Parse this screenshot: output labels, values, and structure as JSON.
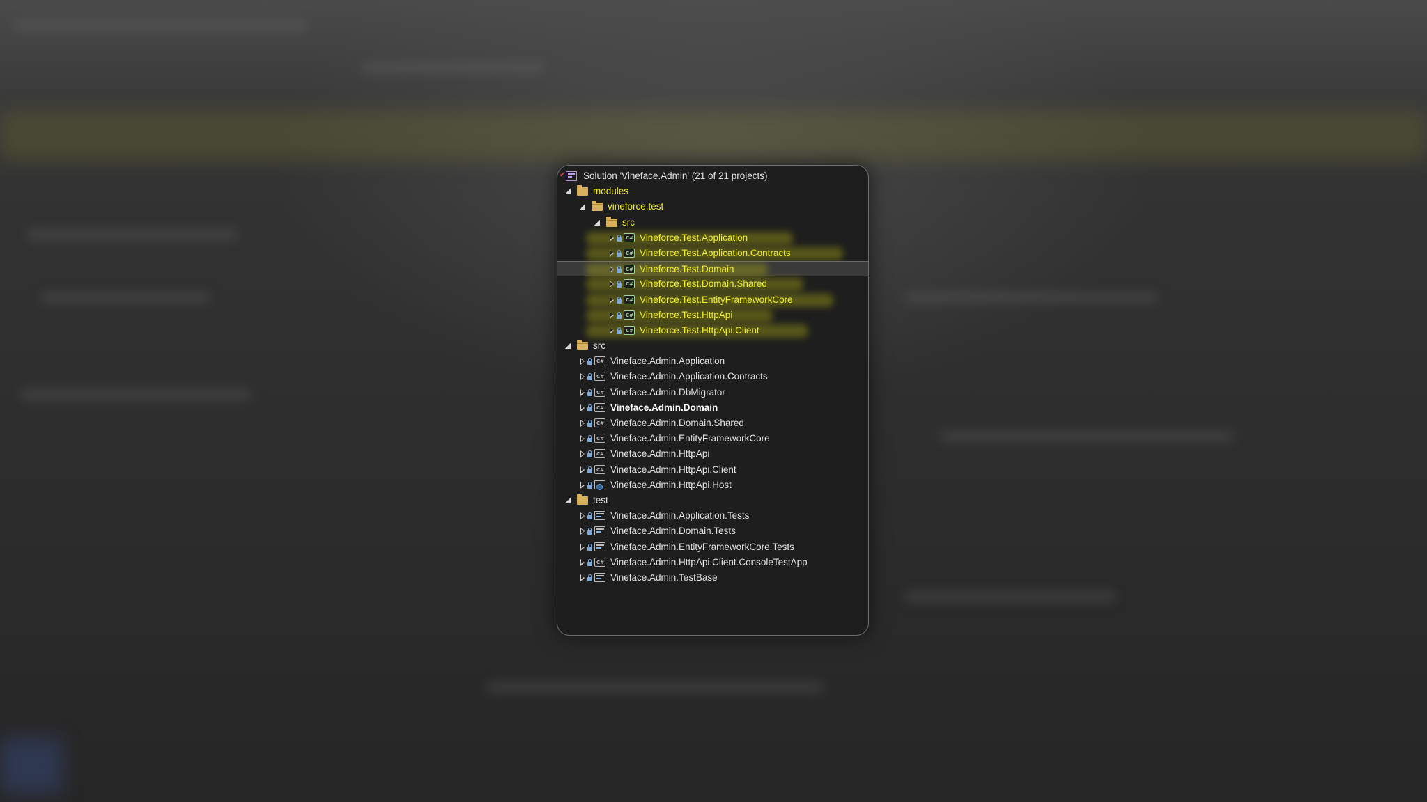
{
  "solution": {
    "title": "Solution 'Vineface.Admin' (21 of 21 projects)"
  },
  "tree": [
    {
      "label": "modules",
      "level": 0,
      "kind": "folder",
      "expanded": true,
      "yellow": true
    },
    {
      "label": "vineforce.test",
      "level": 1,
      "kind": "folder",
      "expanded": true,
      "yellow": true
    },
    {
      "label": "src",
      "level": 2,
      "kind": "folder",
      "expanded": true,
      "yellow": true
    },
    {
      "label": "Vineforce.Test.Application",
      "level": 3,
      "kind": "project",
      "yellow": true,
      "highlight": true
    },
    {
      "label": "Vineforce.Test.Application.Contracts",
      "level": 3,
      "kind": "project",
      "yellow": true,
      "highlight": true
    },
    {
      "label": "Vineforce.Test.Domain",
      "level": 3,
      "kind": "project",
      "yellow": true,
      "highlight": true,
      "selected": true
    },
    {
      "label": "Vineforce.Test.Domain.Shared",
      "level": 3,
      "kind": "project",
      "yellow": true,
      "highlight": true
    },
    {
      "label": "Vineforce.Test.EntityFrameworkCore",
      "level": 3,
      "kind": "project",
      "yellow": true,
      "highlight": true
    },
    {
      "label": "Vineforce.Test.HttpApi",
      "level": 3,
      "kind": "project",
      "yellow": true,
      "highlight": true
    },
    {
      "label": "Vineforce.Test.HttpApi.Client",
      "level": 3,
      "kind": "project",
      "yellow": true,
      "highlight": true
    },
    {
      "label": "src",
      "level": 0,
      "kind": "folder",
      "expanded": true
    },
    {
      "label": "Vineface.Admin.Application",
      "level": 1,
      "kind": "project"
    },
    {
      "label": "Vineface.Admin.Application.Contracts",
      "level": 1,
      "kind": "project"
    },
    {
      "label": "Vineface.Admin.DbMigrator",
      "level": 1,
      "kind": "project"
    },
    {
      "label": "Vineface.Admin.Domain",
      "level": 1,
      "kind": "project",
      "bold": true
    },
    {
      "label": "Vineface.Admin.Domain.Shared",
      "level": 1,
      "kind": "project"
    },
    {
      "label": "Vineface.Admin.EntityFrameworkCore",
      "level": 1,
      "kind": "project"
    },
    {
      "label": "Vineface.Admin.HttpApi",
      "level": 1,
      "kind": "project"
    },
    {
      "label": "Vineface.Admin.HttpApi.Client",
      "level": 1,
      "kind": "project"
    },
    {
      "label": "Vineface.Admin.HttpApi.Host",
      "level": 1,
      "kind": "host"
    },
    {
      "label": "test",
      "level": 0,
      "kind": "folder",
      "expanded": true
    },
    {
      "label": "Vineface.Admin.Application.Tests",
      "level": 1,
      "kind": "test"
    },
    {
      "label": "Vineface.Admin.Domain.Tests",
      "level": 1,
      "kind": "test"
    },
    {
      "label": "Vineface.Admin.EntityFrameworkCore.Tests",
      "level": 1,
      "kind": "test"
    },
    {
      "label": "Vineface.Admin.HttpApi.Client.ConsoleTestApp",
      "level": 1,
      "kind": "project"
    },
    {
      "label": "Vineface.Admin.TestBase",
      "level": 1,
      "kind": "test"
    }
  ],
  "colors": {
    "highlight_text": "#f2ef2a",
    "panel_bg": "#1e1e1e",
    "selection_bg": "#3a3a3a"
  }
}
